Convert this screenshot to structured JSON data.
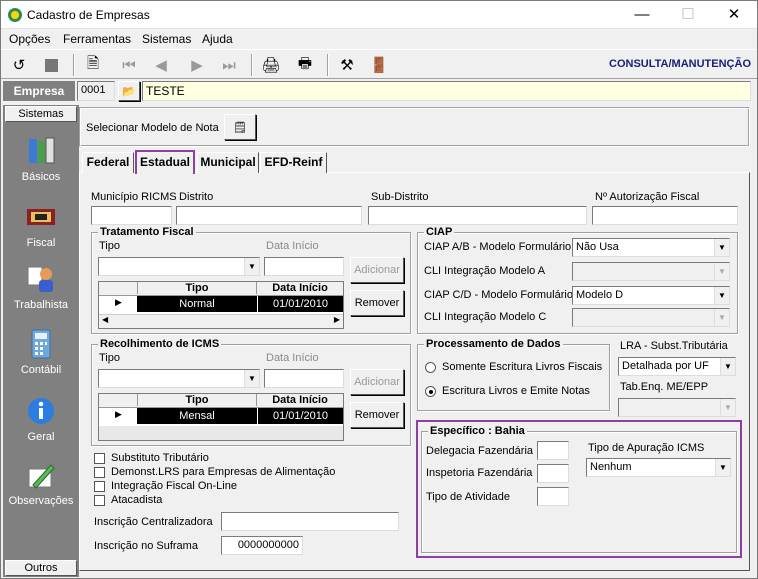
{
  "window": {
    "title": "Cadastro de Empresas"
  },
  "menu": [
    "Opções",
    "Ferramentas",
    "Sistemas",
    "Ajuda"
  ],
  "toolbar": {
    "mode": "CONSULTA/MANUTENÇÃO"
  },
  "empresa": {
    "label": "Empresa",
    "code": "0001",
    "name": "TESTE"
  },
  "sidebar": {
    "header": "Sistemas",
    "footer": "Outros",
    "items": [
      {
        "label": "Básicos",
        "icon": "books-icon"
      },
      {
        "label": "Fiscal",
        "icon": "fiscal-icon"
      },
      {
        "label": "Trabalhista",
        "icon": "worker-icon"
      },
      {
        "label": "Contábil",
        "icon": "calculator-icon"
      },
      {
        "label": "Geral",
        "icon": "info-globe-icon"
      },
      {
        "label": "Observações",
        "icon": "pencil-paper-icon"
      }
    ]
  },
  "modelo": {
    "label": "Selecionar Modelo de Nota"
  },
  "tabs": [
    "Federal",
    "Estadual",
    "Municipal",
    "EFD-Reinf"
  ],
  "active_tab": "Estadual",
  "fields": {
    "municipio_ricms": "Município RICMS",
    "distrito": "Distrito",
    "sub_distrito": "Sub-Distrito",
    "autorizacao": "Nº Autorização Fiscal"
  },
  "tratamento": {
    "title": "Tratamento Fiscal",
    "tipo_label": "Tipo",
    "data_label": "Data Início",
    "add": "Adicionar",
    "remove": "Remover",
    "col_tipo": "Tipo",
    "col_data": "Data Início",
    "row_tipo": "Normal",
    "row_data": "01/01/2010"
  },
  "recolhimento": {
    "title": "Recolhimento de ICMS",
    "tipo_label": "Tipo",
    "data_label": "Data Início",
    "add": "Adicionar",
    "remove": "Remover",
    "col_tipo": "Tipo",
    "col_data": "Data Início",
    "row_tipo": "Mensal",
    "row_data": "01/01/2010"
  },
  "ciap": {
    "title": "CIAP",
    "ab_label": "CIAP  A/B - Modelo Formulário",
    "ab_value": "Não Usa",
    "cli_a_label": "CLI Integração Modelo A",
    "cd_label": "CIAP C/D - Modelo Formulário",
    "cd_value": "Modelo D",
    "cli_c_label": "CLI Integração Modelo C"
  },
  "processamento": {
    "title": "Processamento de Dados",
    "opt1": "Somente Escritura Livros Fiscais",
    "opt2": "Escritura Livros e Emite Notas",
    "selected": 2
  },
  "lra": {
    "label": "LRA - Subst.Tributária",
    "value": "Detalhada por UF",
    "tab_label": "Tab.Enq. ME/EPP"
  },
  "checks": [
    "Substituto Tributário",
    "Demonst.LRS para Empresas de Alimentação",
    "Integração Fiscal On-Line",
    "Atacadista"
  ],
  "inscricao": {
    "centralizadora_label": "Inscrição Centralizadora",
    "suframa_label": "Inscrição no Suframa",
    "suframa_value": "0000000000"
  },
  "especifico": {
    "title": "Específico : Bahia",
    "delegacia": "Delegacia Fazendária",
    "inspetoria": "Inspetoria Fazendária",
    "atividade": "Tipo de Atividade",
    "apuracao_label": "Tipo de Apuração ICMS",
    "apuracao_value": "Nenhum"
  },
  "colors": {
    "highlight": "#8e3fa3",
    "yellow_field": "#ffffe1",
    "mode_text": "#1c1c7a"
  }
}
